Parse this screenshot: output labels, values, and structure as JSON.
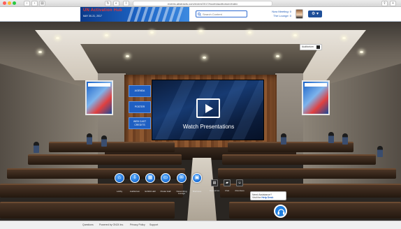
{
  "browser": {
    "url": "events.abstracts.com/event/2017/booth/auditorium/index"
  },
  "header": {
    "event_title": "UN Activation Hub",
    "event_dates": "MAY 30-31, 2017",
    "search_placeholder": "Search Content",
    "now_meeting": "Now Meeting: 0",
    "live_lounge": "The Lounge: 0",
    "settings_label": "⚙ ▾"
  },
  "scene": {
    "video_label": "Watch Presentations",
    "side_buttons": [
      "AGENDA",
      "POSTER",
      "WEB CAST CREDITS"
    ],
    "top_button": "Auditorium"
  },
  "dock": {
    "items": [
      {
        "label": "Lobby",
        "icon": "home-icon"
      },
      {
        "label": "Auditorium",
        "icon": "auditorium-icon"
      },
      {
        "label": "Exhibit Hall",
        "icon": "exhibit-icon"
      },
      {
        "label": "Poster Hall",
        "icon": "poster-icon"
      },
      {
        "label": "Networking Lounge",
        "icon": "chat-icon"
      },
      {
        "label": "Briefcase",
        "icon": "briefcase-icon"
      }
    ],
    "small_items": [
      {
        "label": "Resources",
        "icon": "resources-icon"
      },
      {
        "label": "Chat",
        "icon": "chat-bubble-icon"
      },
      {
        "label": "Attendees",
        "icon": "attendees-icon"
      }
    ]
  },
  "help": {
    "line1": "Need Assistance?",
    "line2_prefix": "Visit the ",
    "line2_strong": "Help Desk"
  },
  "footer": {
    "links": [
      "Questions",
      "Powered by ON24 Inc.",
      "Privacy Policy",
      "Support"
    ]
  },
  "colors": {
    "accent": "#1f5fc2",
    "title_red": "#e53535"
  }
}
